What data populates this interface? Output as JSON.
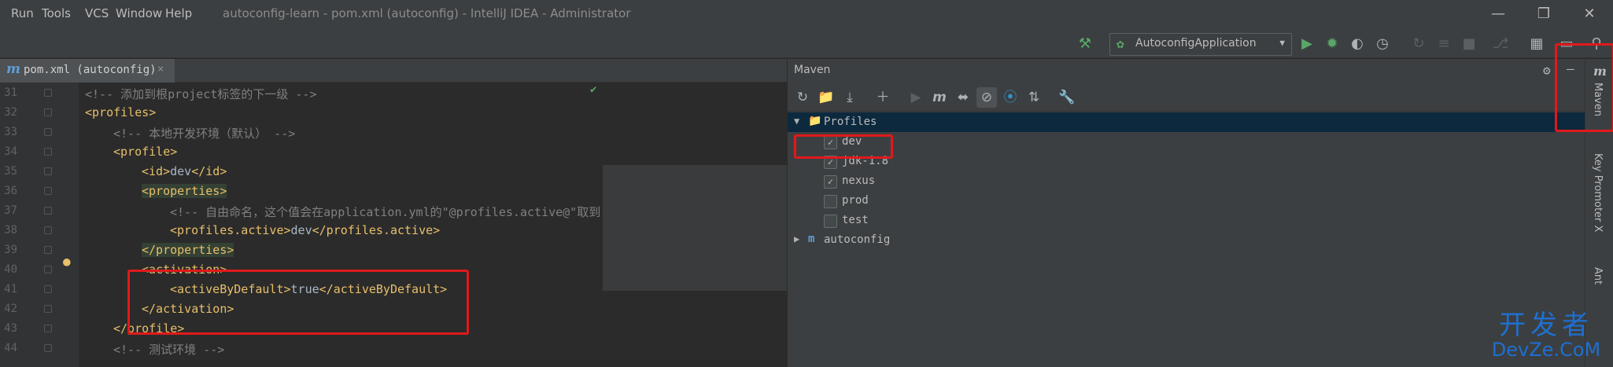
{
  "menu": [
    "Run",
    "Tools",
    "VCS",
    "Window",
    "Help"
  ],
  "window_title": "autoconfig-learn - pom.xml (autoconfig) - IntelliJ IDEA - Administrator",
  "run_config": "AutoconfigApplication",
  "editor_tab": {
    "icon": "m",
    "label": "pom.xml (autoconfig)"
  },
  "code_lines": [
    {
      "n": "31",
      "indent": 1,
      "kind": "comment",
      "text": "<!-- 添加到根project标签的下一级 -->"
    },
    {
      "n": "32",
      "indent": 1,
      "kind": "tag",
      "text": "<profiles>"
    },
    {
      "n": "33",
      "indent": 2,
      "kind": "comment",
      "text": "<!-- 本地开发环境（默认） -->"
    },
    {
      "n": "34",
      "indent": 2,
      "kind": "tag",
      "text": "<profile>"
    },
    {
      "n": "35",
      "indent": 3,
      "kind": "mixed",
      "open": "<id>",
      "value": "dev",
      "close": "</id>"
    },
    {
      "n": "36",
      "indent": 3,
      "kind": "tag",
      "text": "<properties>"
    },
    {
      "n": "37",
      "indent": 4,
      "kind": "comment",
      "text": "<!-- 自由命名，这个值会在application.yml的\"@profiles.active@\"取到"
    },
    {
      "n": "38",
      "indent": 4,
      "kind": "mixed",
      "open": "<profiles.active>",
      "value": "dev",
      "close": "</profiles.active>"
    },
    {
      "n": "39",
      "indent": 3,
      "kind": "tag",
      "text": "</properties>"
    },
    {
      "n": "40",
      "indent": 3,
      "kind": "tag",
      "text": "<activation>"
    },
    {
      "n": "41",
      "indent": 4,
      "kind": "mixed",
      "open": "<activeByDefault>",
      "value": "true",
      "close": "</activeByDefault>"
    },
    {
      "n": "42",
      "indent": 3,
      "kind": "tag",
      "text": "</activation>"
    },
    {
      "n": "43",
      "indent": 2,
      "kind": "tag",
      "text": "</profile>"
    },
    {
      "n": "44",
      "indent": 2,
      "kind": "comment",
      "text": "<!-- 测试环境 -->"
    }
  ],
  "maven": {
    "title": "Maven",
    "profiles_label": "Profiles",
    "profiles": [
      {
        "name": "dev",
        "checked": true
      },
      {
        "name": "jdk-1.8",
        "checked": true
      },
      {
        "name": "nexus",
        "checked": true
      },
      {
        "name": "prod",
        "checked": false
      },
      {
        "name": "test",
        "checked": false
      }
    ],
    "project": "autoconfig"
  },
  "right_tabs": [
    "Maven",
    "Key Promoter X",
    "Ant"
  ],
  "watermark": {
    "line1": "开发者",
    "line2": "DevZe.CoM"
  },
  "colors": {
    "accent": "#4a88c7",
    "highlight_box": "#e0191b",
    "tag": "#e8bf6a",
    "comment": "#808080"
  }
}
